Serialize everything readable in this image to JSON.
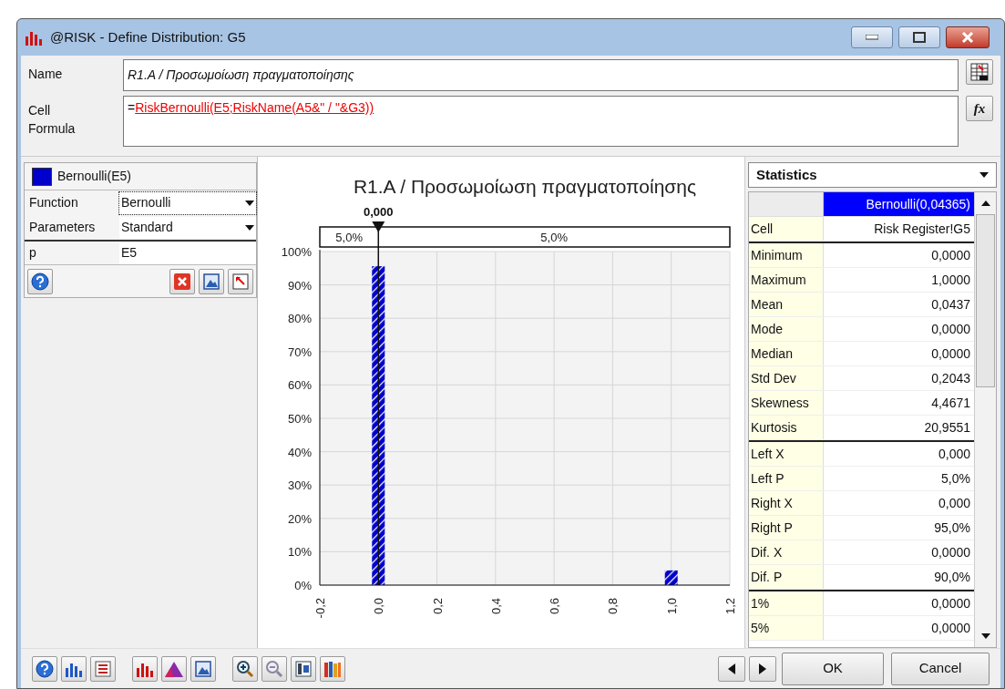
{
  "window": {
    "title": "@RISK - Define Distribution: G5"
  },
  "name_field": {
    "label": "Name",
    "value": "R1.A / Προσωμοίωση πραγματοποίησης"
  },
  "formula_field": {
    "function_button": "fx",
    "label_lines": [
      "Cell",
      "Formula"
    ],
    "prefix": "=",
    "value": "RiskBernoulli(E5;RiskName(A5&\" / \"&G3))"
  },
  "distribution": {
    "header": "Bernoulli(E5)",
    "color": "#0000cc",
    "rows": [
      {
        "label": "Function",
        "value": "Bernoulli",
        "kind": "dropdown",
        "focused": true
      },
      {
        "label": "Parameters",
        "value": "Standard",
        "kind": "dropdown",
        "focused": false
      },
      {
        "label": "p",
        "value": "E5",
        "kind": "text",
        "focused": false
      }
    ]
  },
  "chart": {
    "delimiter_value": "0,000",
    "left_share": "5,0%",
    "right_share": "5,0%",
    "chart_data": {
      "type": "bar",
      "title": "R1.A / Προσωμοίωση πραγματοποίησης",
      "x": [
        0,
        1
      ],
      "grid": true,
      "series": [
        {
          "color": "#0000cc",
          "values": [
            0.956,
            0.044
          ]
        }
      ],
      "xlim": [
        -0.2,
        1.2
      ],
      "ylim": [
        0,
        1
      ],
      "xticks": [
        {
          "value": -0.2,
          "label": "-0,2"
        },
        {
          "value": 0,
          "label": "0,0"
        },
        {
          "value": 0.2,
          "label": "0,2"
        },
        {
          "value": 0.4,
          "label": "0,4"
        },
        {
          "value": 0.6,
          "label": "0,6"
        },
        {
          "value": 0.8,
          "label": "0,8"
        },
        {
          "value": 1,
          "label": "1,0"
        },
        {
          "value": 1.2,
          "label": "1,2"
        }
      ],
      "yticks": [
        {
          "value": 0,
          "label": "0%"
        },
        {
          "value": 0.1,
          "label": "10%"
        },
        {
          "value": 0.2,
          "label": "20%"
        },
        {
          "value": 0.3,
          "label": "30%"
        },
        {
          "value": 0.4,
          "label": "40%"
        },
        {
          "value": 0.5,
          "label": "50%"
        },
        {
          "value": 0.6,
          "label": "60%"
        },
        {
          "value": 0.7,
          "label": "70%"
        },
        {
          "value": 0.8,
          "label": "80%"
        },
        {
          "value": 0.9,
          "label": "90%"
        },
        {
          "value": 1,
          "label": "100%"
        }
      ]
    }
  },
  "statistics": {
    "selector": "Statistics",
    "column_header": "Bernoulli(0,04365)",
    "groups": [
      [
        {
          "label": "Cell",
          "value": "Risk Register!G5"
        }
      ],
      [
        {
          "label": "Minimum",
          "value": "0,0000"
        },
        {
          "label": "Maximum",
          "value": "1,0000"
        },
        {
          "label": "Mean",
          "value": "0,0437"
        },
        {
          "label": "Mode",
          "value": "0,0000"
        },
        {
          "label": "Median",
          "value": "0,0000"
        },
        {
          "label": "Std Dev",
          "value": "0,2043"
        },
        {
          "label": "Skewness",
          "value": "4,4671"
        },
        {
          "label": "Kurtosis",
          "value": "20,9551"
        }
      ],
      [
        {
          "label": "Left X",
          "value": "0,000"
        },
        {
          "label": "Left P",
          "value": "5,0%"
        },
        {
          "label": "Right X",
          "value": "0,000"
        },
        {
          "label": "Right P",
          "value": "95,0%"
        },
        {
          "label": "Dif. X",
          "value": "0,0000"
        },
        {
          "label": "Dif. P",
          "value": "90,0%"
        }
      ],
      [
        {
          "label": "1%",
          "value": "0,0000"
        },
        {
          "label": "5%",
          "value": "0,0000"
        }
      ]
    ]
  },
  "buttons": {
    "ok": "OK",
    "cancel": "Cancel"
  }
}
